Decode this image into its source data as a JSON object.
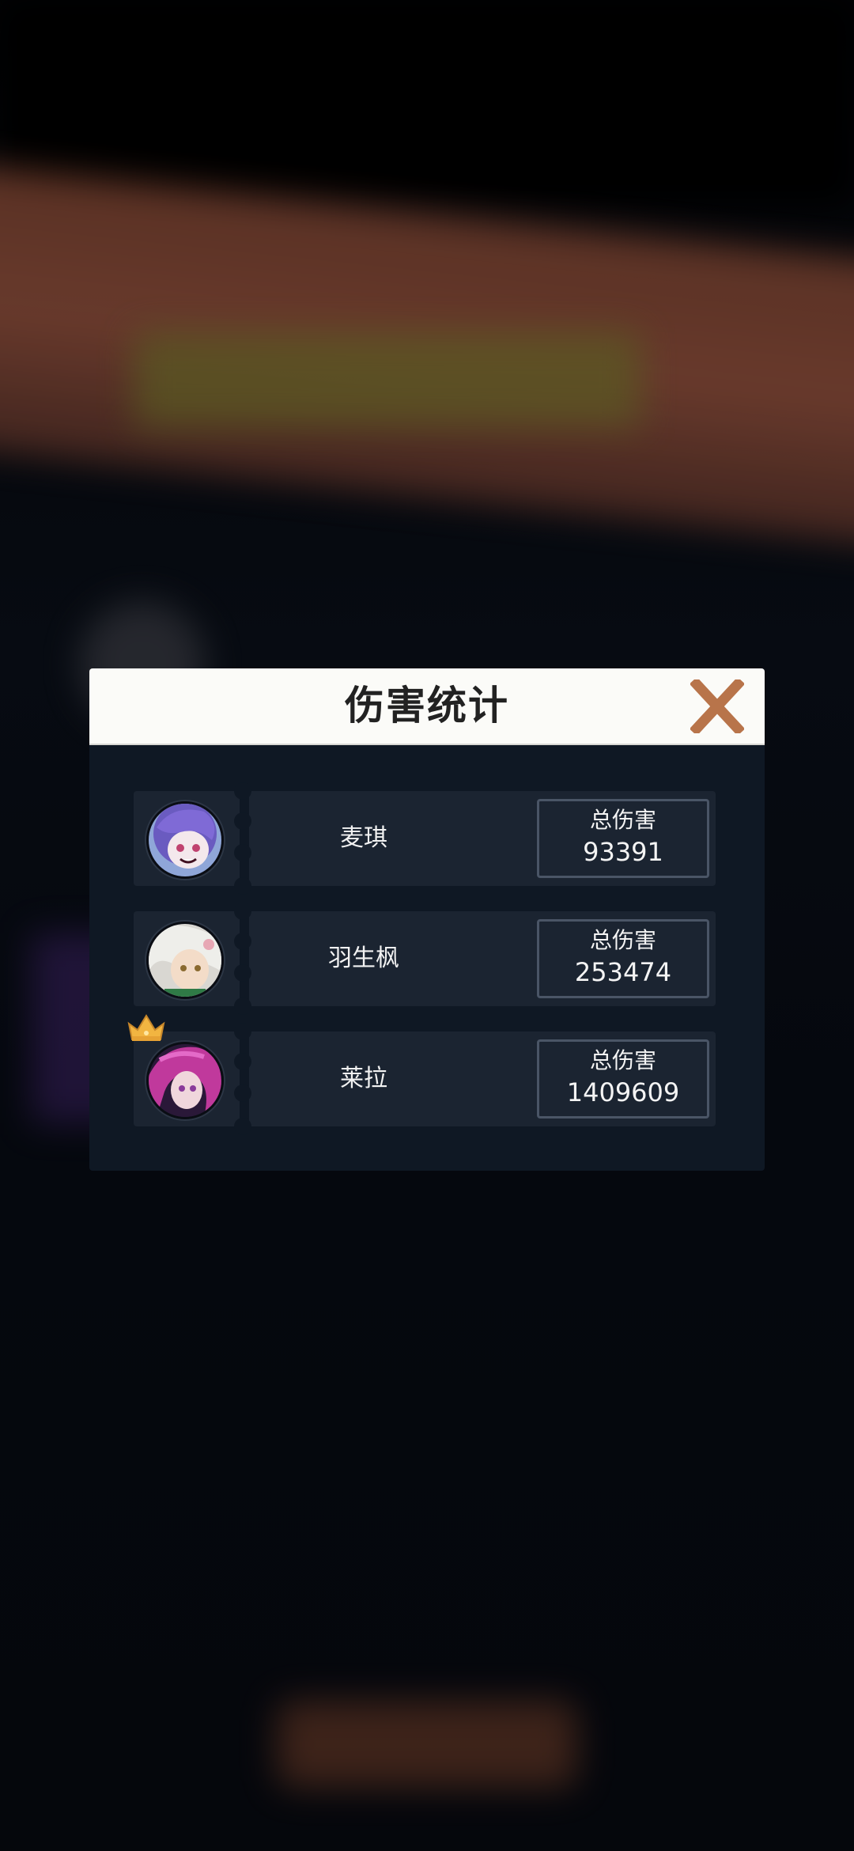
{
  "dialog": {
    "title": "伤害统计"
  },
  "players": [
    {
      "name": "麦琪",
      "damage_label": "总伤害",
      "damage": "93391",
      "top": false
    },
    {
      "name": "羽生枫",
      "damage_label": "总伤害",
      "damage": "253474",
      "top": false
    },
    {
      "name": "莱拉",
      "damage_label": "总伤害",
      "damage": "1409609",
      "top": true
    }
  ],
  "icons": {
    "close": "close-x-icon",
    "crown": "crown-icon"
  },
  "colors": {
    "close": "#b8744a",
    "crown": "#f2b541",
    "panel": "#0f1824",
    "row": "#1b2431"
  }
}
